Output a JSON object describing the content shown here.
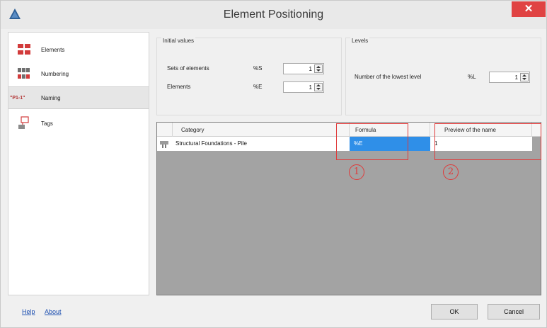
{
  "window": {
    "title": "Element Positioning",
    "close_glyph": "✕"
  },
  "nav": {
    "items": [
      {
        "label": "Elements",
        "icon": "elements-icon"
      },
      {
        "label": "Numbering",
        "icon": "numbering-icon"
      },
      {
        "label": "Naming",
        "icon": "naming-icon",
        "selected": true,
        "prefix": "\"P1-1\""
      },
      {
        "label": "Tags",
        "icon": "tags-icon"
      }
    ]
  },
  "initial_values": {
    "title": "Initial values",
    "sets_label": "Sets of elements",
    "sets_code": "%S",
    "sets_value": "1",
    "elements_label": "Elements",
    "elements_code": "%E",
    "elements_value": "1"
  },
  "levels": {
    "title": "Levels",
    "lowest_label": "Number of the lowest level",
    "lowest_code": "%L",
    "lowest_value": "1"
  },
  "grid": {
    "columns": [
      "Category",
      "Formula",
      "Preview of the name"
    ],
    "rows": [
      {
        "category": "Structural Foundations - Pile",
        "formula": "%E",
        "preview": "1"
      }
    ]
  },
  "annotations": {
    "callout_1": "1",
    "callout_2": "2"
  },
  "footer": {
    "help": "Help",
    "about": "About",
    "ok": "OK",
    "cancel": "Cancel"
  },
  "colors": {
    "selection": "#2f8fe8",
    "annotation": "#e03a3a",
    "close": "#e04343",
    "grid_bg": "#a3a3a3"
  }
}
